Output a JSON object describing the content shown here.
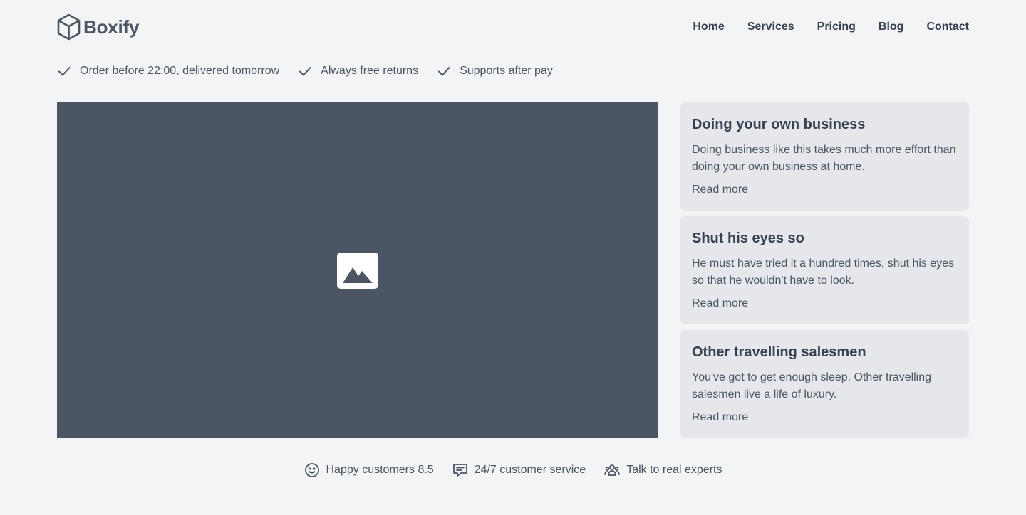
{
  "brand": {
    "name": "Boxify",
    "icon": "cube-icon"
  },
  "nav": {
    "items": [
      {
        "label": "Home"
      },
      {
        "label": "Services"
      },
      {
        "label": "Pricing"
      },
      {
        "label": "Blog"
      },
      {
        "label": "Contact"
      }
    ]
  },
  "usps": [
    {
      "icon": "check-icon",
      "label": "Order before 22:00, delivered tomorrow"
    },
    {
      "icon": "check-icon",
      "label": "Always free returns"
    },
    {
      "icon": "check-icon",
      "label": "Supports after pay"
    }
  ],
  "hero": {
    "icon": "image-placeholder-icon"
  },
  "cards": [
    {
      "title": "Doing your own business",
      "text": "Doing business like this takes much more effort than doing your own business at home.",
      "link": "Read more"
    },
    {
      "title": "Shut his eyes so",
      "text": "He must have tried it a hundred times, shut his eyes so that he wouldn't have to look.",
      "link": "Read more"
    },
    {
      "title": "Other travelling salesmen",
      "text": "You've got to get enough sleep. Other travelling salesmen live a life of luxury.",
      "link": "Read more"
    }
  ],
  "features": [
    {
      "icon": "smiley-icon",
      "label": "Happy customers 8.5"
    },
    {
      "icon": "chat-icon",
      "label": "24/7 customer service"
    },
    {
      "icon": "users-icon",
      "label": "Talk to real experts"
    }
  ],
  "colors": {
    "background": "#f3f4f6",
    "hero": "#4b5563",
    "card": "#e5e7eb",
    "text": "#4b5563",
    "heading": "#374151"
  }
}
